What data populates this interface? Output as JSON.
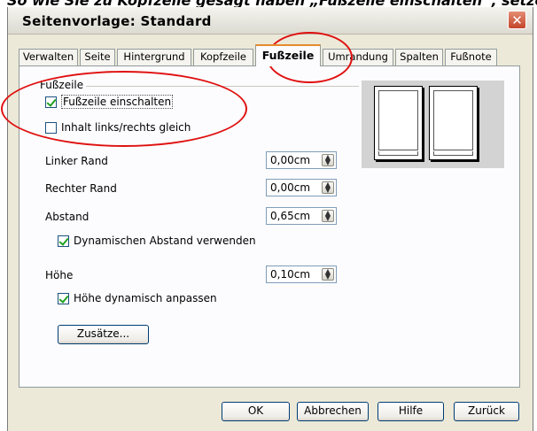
{
  "top_text": "So wie Sie zu Kopfzeile gesagt haben „Fußzeile einschalten“, setzen Sie",
  "window": {
    "title": "Seitenvorlage: Standard",
    "close_glyph": "✕"
  },
  "tabs": [
    {
      "label": "Verwalten"
    },
    {
      "label": "Seite"
    },
    {
      "label": "Hintergrund"
    },
    {
      "label": "Kopfzeile"
    },
    {
      "label": "Fußzeile",
      "active": true
    },
    {
      "label": "Umrandung"
    },
    {
      "label": "Spalten"
    },
    {
      "label": "Fußnote"
    }
  ],
  "group": {
    "label": "Fußzeile"
  },
  "checkboxes": {
    "footer_on": {
      "label": "Fußzeile einschalten",
      "checked": true
    },
    "same_content": {
      "label": "Inhalt links/rechts gleich",
      "checked": false
    },
    "dynamic_spacing": {
      "label": "Dynamischen Abstand verwenden",
      "checked": true
    },
    "auto_height": {
      "label": "Höhe dynamisch anpassen",
      "checked": true
    }
  },
  "fields": {
    "left_margin": {
      "label": "Linker Rand",
      "value": "0,00cm"
    },
    "right_margin": {
      "label": "Rechter Rand",
      "value": "0,00cm"
    },
    "spacing": {
      "label": "Abstand",
      "value": "0,65cm"
    },
    "height": {
      "label": "Höhe",
      "value": "0,10cm"
    }
  },
  "buttons": {
    "more": "Zusätze...",
    "ok": "OK",
    "cancel": "Abbrechen",
    "help": "Hilfe",
    "reset": "Zurück"
  },
  "colors": {
    "annotation_red": "#e01010",
    "active_tab_accent": "#e68b2c",
    "check_green": "#21a121"
  }
}
